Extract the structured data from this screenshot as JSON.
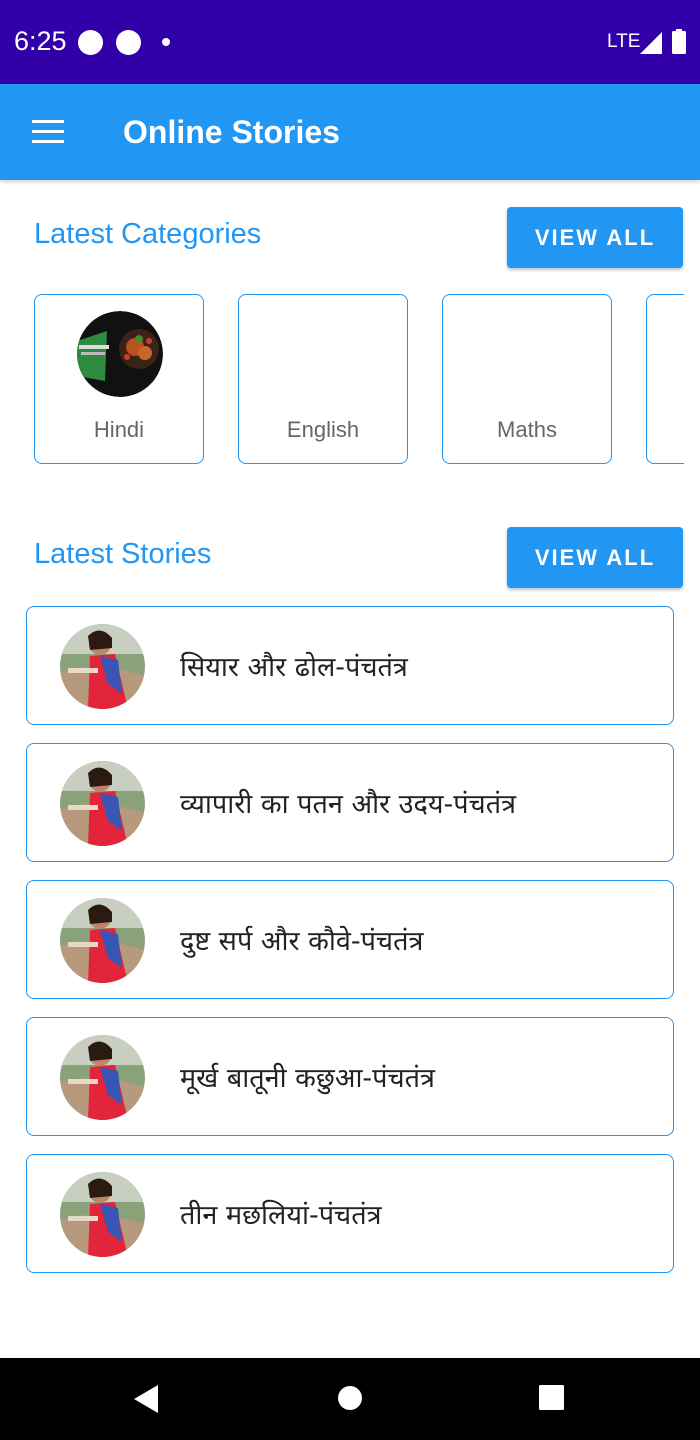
{
  "status_bar": {
    "time": "6:25",
    "network": "LTE"
  },
  "app_bar": {
    "title": "Online Stories",
    "menu_icon": "hamburger-menu-icon"
  },
  "categories_section": {
    "title": "Latest Categories",
    "view_all_label": "VIEW ALL",
    "items": [
      {
        "label": "Hindi",
        "has_image": true
      },
      {
        "label": "English",
        "has_image": false
      },
      {
        "label": "Maths",
        "has_image": false
      },
      {
        "label": "",
        "has_image": false
      }
    ]
  },
  "stories_section": {
    "title": "Latest Stories",
    "view_all_label": "VIEW ALL",
    "items": [
      {
        "title": "सियार और ढोल-पंचतंत्र"
      },
      {
        "title": "व्यापारी का पतन और उदय-पंचतंत्र"
      },
      {
        "title": "दुष्ट सर्प और कौवे-पंचतंत्र"
      },
      {
        "title": "मूर्ख बातूनी कछुआ-पंचतंत्र"
      },
      {
        "title": "तीन मछलियां-पंचतंत्र"
      }
    ]
  },
  "colors": {
    "status_bar": "#3200A9",
    "primary": "#2196F3"
  },
  "nav_bar": {
    "icons": [
      "back-icon",
      "home-icon",
      "recents-icon"
    ]
  }
}
